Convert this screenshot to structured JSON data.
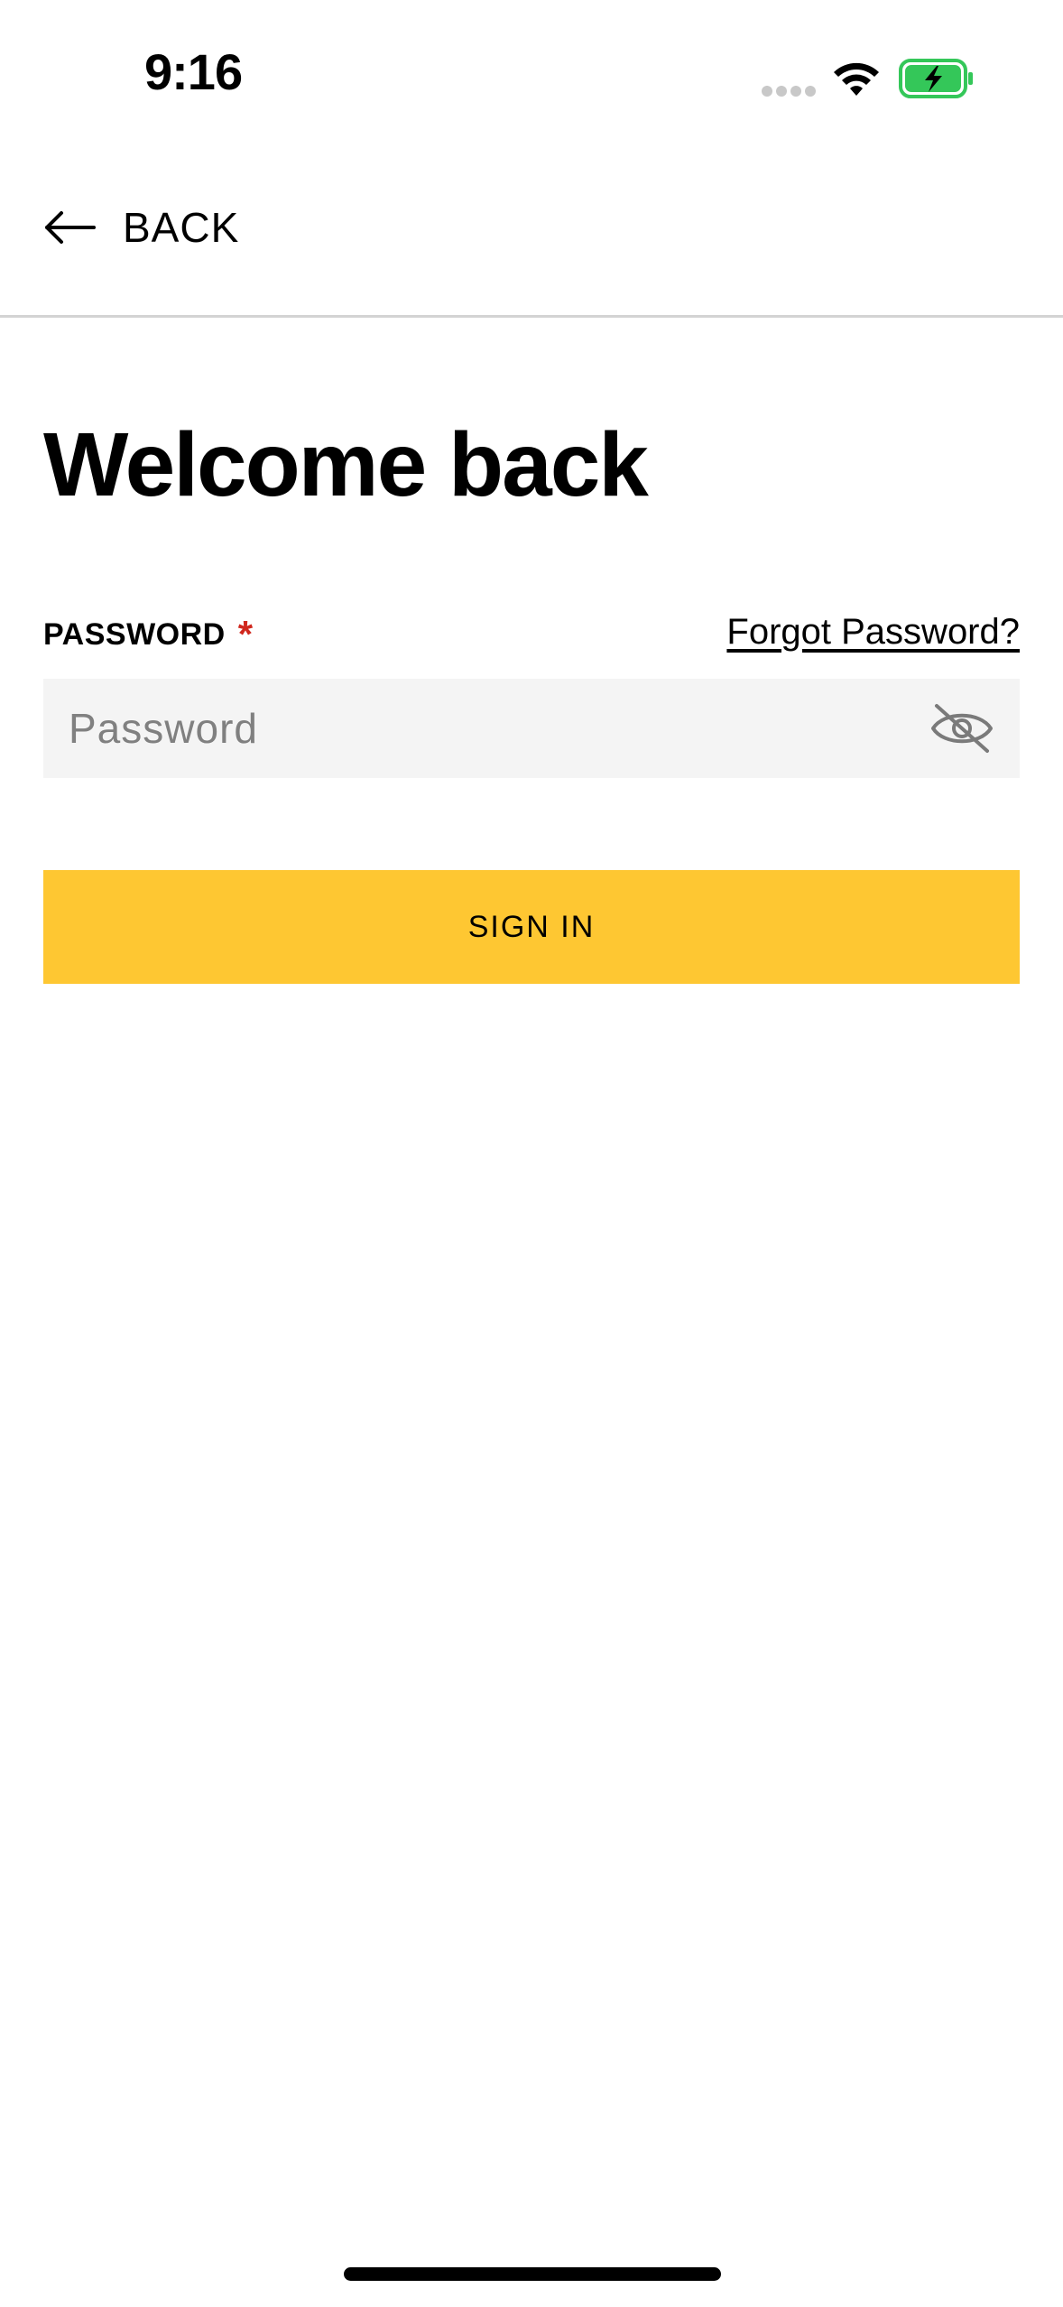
{
  "status_bar": {
    "time": "9:16",
    "icons": [
      "signal-dots-icon",
      "wifi-icon",
      "battery-charging-icon"
    ],
    "battery_color": "#34c759"
  },
  "header": {
    "back_label": "BACK",
    "back_icon": "arrow-left-icon"
  },
  "main": {
    "title": "Welcome back",
    "password_label": "PASSWORD",
    "required_marker": "*",
    "forgot_password_label": "Forgot Password?",
    "password_placeholder": "Password",
    "password_value": "",
    "visibility_icon": "eye-off-icon",
    "signin_label": "SIGN IN"
  },
  "colors": {
    "accent": "#fec732",
    "required": "#d0271d",
    "field_background": "#f4f4f4",
    "divider": "#d3d3d3"
  }
}
